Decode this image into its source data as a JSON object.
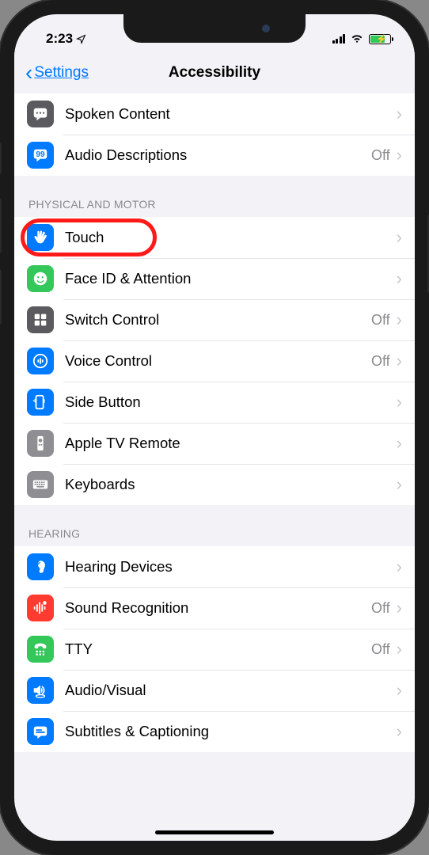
{
  "status": {
    "time": "2:23",
    "location_arrow": "➤"
  },
  "nav": {
    "back_label": "Settings",
    "title": "Accessibility"
  },
  "visible_top": [
    {
      "label": "Spoken Content",
      "value": "",
      "icon": "speech-bubble",
      "bg": "bg-darkgray"
    },
    {
      "label": "Audio Descriptions",
      "value": "Off",
      "icon": "quote-bubble",
      "bg": "bg-blue"
    }
  ],
  "sections": [
    {
      "header": "Physical and Motor",
      "items": [
        {
          "label": "Touch",
          "value": "",
          "icon": "hand",
          "bg": "bg-blue",
          "highlight": true
        },
        {
          "label": "Face ID & Attention",
          "value": "",
          "icon": "face",
          "bg": "bg-green"
        },
        {
          "label": "Switch Control",
          "value": "Off",
          "icon": "grid4",
          "bg": "bg-darkgray"
        },
        {
          "label": "Voice Control",
          "value": "Off",
          "icon": "voice",
          "bg": "bg-blue"
        },
        {
          "label": "Side Button",
          "value": "",
          "icon": "side-button",
          "bg": "bg-blue"
        },
        {
          "label": "Apple TV Remote",
          "value": "",
          "icon": "remote",
          "bg": "bg-gray"
        },
        {
          "label": "Keyboards",
          "value": "",
          "icon": "keyboard",
          "bg": "bg-gray"
        }
      ]
    },
    {
      "header": "Hearing",
      "items": [
        {
          "label": "Hearing Devices",
          "value": "",
          "icon": "ear",
          "bg": "bg-blue"
        },
        {
          "label": "Sound Recognition",
          "value": "Off",
          "icon": "waveform",
          "bg": "bg-red"
        },
        {
          "label": "TTY",
          "value": "Off",
          "icon": "tty",
          "bg": "bg-green"
        },
        {
          "label": "Audio/Visual",
          "value": "",
          "icon": "audiovisual",
          "bg": "bg-blue"
        },
        {
          "label": "Subtitles & Captioning",
          "value": "",
          "icon": "subtitle",
          "bg": "bg-blue"
        }
      ]
    }
  ]
}
